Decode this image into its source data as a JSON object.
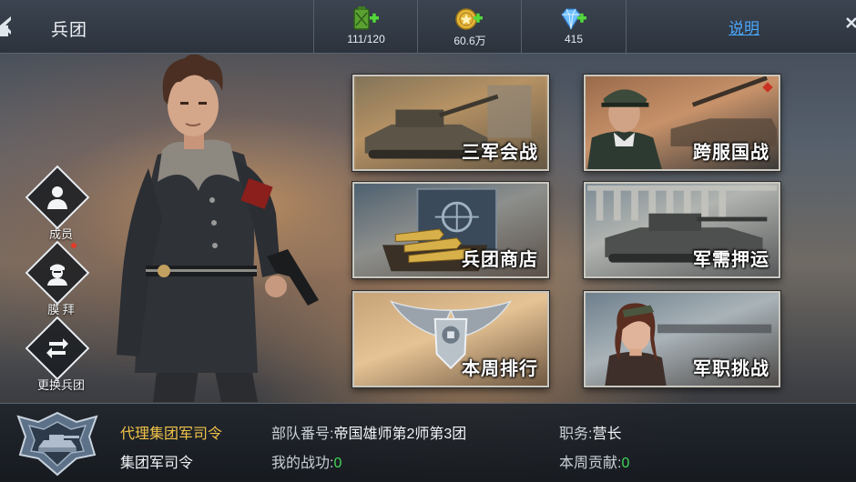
{
  "header": {
    "title": "兵团",
    "help_label": "说明"
  },
  "resources": [
    {
      "icon": "fuel-can-icon",
      "value": "111/120"
    },
    {
      "icon": "gold-coin-icon",
      "value": "60.6万"
    },
    {
      "icon": "diamond-icon",
      "value": "415"
    }
  ],
  "side_menu": [
    {
      "label": "成员",
      "icon": "member-icon",
      "has_notice": false
    },
    {
      "label": "膜 拜",
      "icon": "worship-icon",
      "has_notice": true
    },
    {
      "label": "更换兵团",
      "icon": "switch-icon",
      "has_notice": false
    }
  ],
  "modes": [
    {
      "label": "三军会战"
    },
    {
      "label": "跨服国战"
    },
    {
      "label": "兵团商店"
    },
    {
      "label": "军需押运"
    },
    {
      "label": "本周排行"
    },
    {
      "label": "军职挑战"
    }
  ],
  "info": {
    "role_title": "代理集团军司令",
    "role_subtitle": "集团军司令",
    "unit_label": "部队番号:",
    "unit_value": "帝国雄师第2师第3团",
    "merit_label": "我的战功:",
    "merit_value": "0",
    "position_label": "职务:",
    "position_value": "营长",
    "weekly_label": "本周贡献:",
    "weekly_value": "0"
  },
  "colors": {
    "accent_gold": "#f0c24a",
    "value_green": "#41d65a",
    "link_blue": "#4aa8ff",
    "notice_red": "#e23b2a"
  }
}
